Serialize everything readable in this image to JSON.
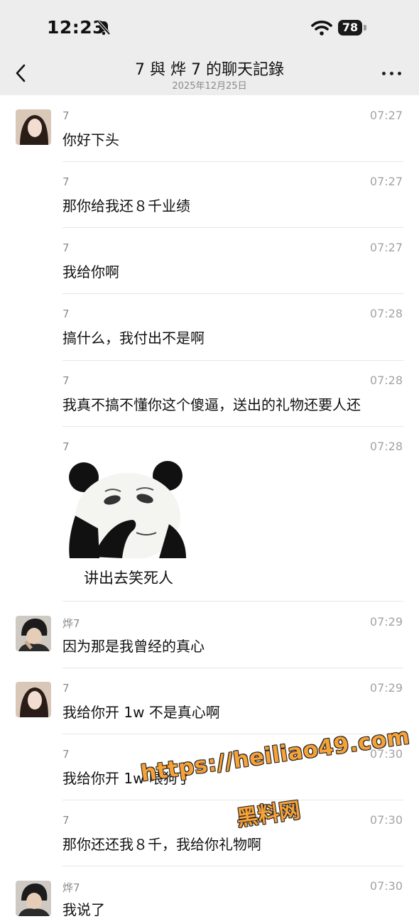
{
  "status": {
    "time": "12:23",
    "battery": "78"
  },
  "nav": {
    "title": "7 與 烨 7 的聊天記錄",
    "date": "2025年12月25日"
  },
  "messages": [
    {
      "sender": "7",
      "time": "07:27",
      "text": "你好下头"
    },
    {
      "sender": "7",
      "time": "07:27",
      "text": "那你给我还８千业绩"
    },
    {
      "sender": "7",
      "time": "07:27",
      "text": "我给你啊"
    },
    {
      "sender": "7",
      "time": "07:28",
      "text": "搞什么，我付出不是啊"
    },
    {
      "sender": "7",
      "time": "07:28",
      "text": "我真不搞不懂你这个傻逼，送出的礼物还要人还"
    },
    {
      "sender": "7",
      "time": "07:28",
      "sticker_caption": "讲出去笑死人"
    },
    {
      "sender": "烨7",
      "time": "07:29",
      "text": "因为那是我曾经的真心"
    },
    {
      "sender": "7",
      "time": "07:29",
      "text": "我给你开 1w 不是真心啊"
    },
    {
      "sender": "7",
      "time": "07:30",
      "text": "我给你开 1w 喂狗了"
    },
    {
      "sender": "7",
      "time": "07:30",
      "text": "那你还还我８千，我给你礼物啊"
    },
    {
      "sender": "烨7",
      "time": "07:30",
      "text": "我说了"
    }
  ],
  "watermark": {
    "url": "https://heiliao49.com",
    "site": "黑料网"
  }
}
